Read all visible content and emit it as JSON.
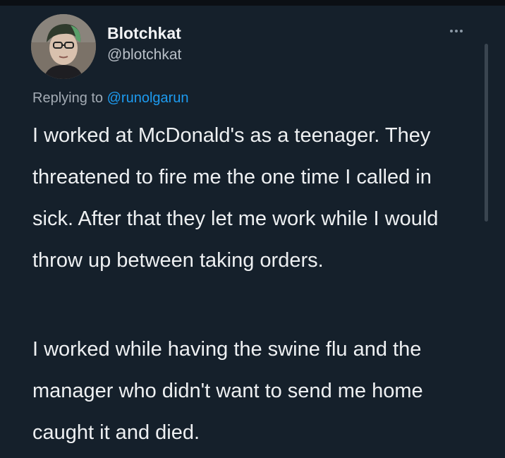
{
  "tweet": {
    "display_name": "Blotchkat",
    "handle": "@blotchkat",
    "more_icon": "more-horizontal-icon",
    "replying_prefix": "Replying to",
    "replying_to": "@runolgarun",
    "paragraphs": [
      "I worked at McDonald's as a teenager. They threatened to fire me the one time I called in sick. After that they let me work while I would throw up between taking orders.",
      "I worked while having the swine flu and the manager who didn't want to send me home caught it and died."
    ]
  },
  "colors": {
    "background": "#15202b",
    "text": "#eef0f2",
    "secondary_text": "#a3abb4",
    "mention": "#1d9bf0"
  }
}
